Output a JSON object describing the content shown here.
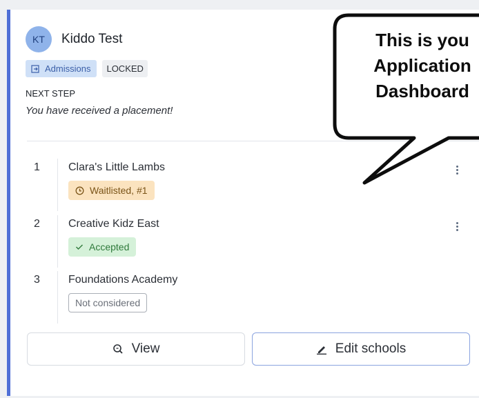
{
  "applicant": {
    "initials": "KT",
    "name": "Kiddo Test"
  },
  "tags": {
    "stage": "Admissions",
    "lock_status": "LOCKED"
  },
  "next_step": {
    "label": "NEXT STEP",
    "text": "You have received a placement!"
  },
  "schools": [
    {
      "rank": "1",
      "name": "Clara's Little Lambs",
      "status": "Waitlisted, #1",
      "status_icon": "clock-icon"
    },
    {
      "rank": "2",
      "name": "Creative Kidz East",
      "status": "Accepted",
      "status_icon": "check-icon"
    },
    {
      "rank": "3",
      "name": "Foundations Academy",
      "status": "Not considered"
    }
  ],
  "actions": {
    "view_label": "View",
    "edit_label": "Edit schools"
  },
  "callout": {
    "line1": "This is you",
    "line2": "Application",
    "line3": "Dashboard"
  },
  "colors": {
    "accent": "#4f6fd6",
    "waitlisted_bg": "#fbe3bf",
    "accepted_bg": "#d5f1d9"
  }
}
